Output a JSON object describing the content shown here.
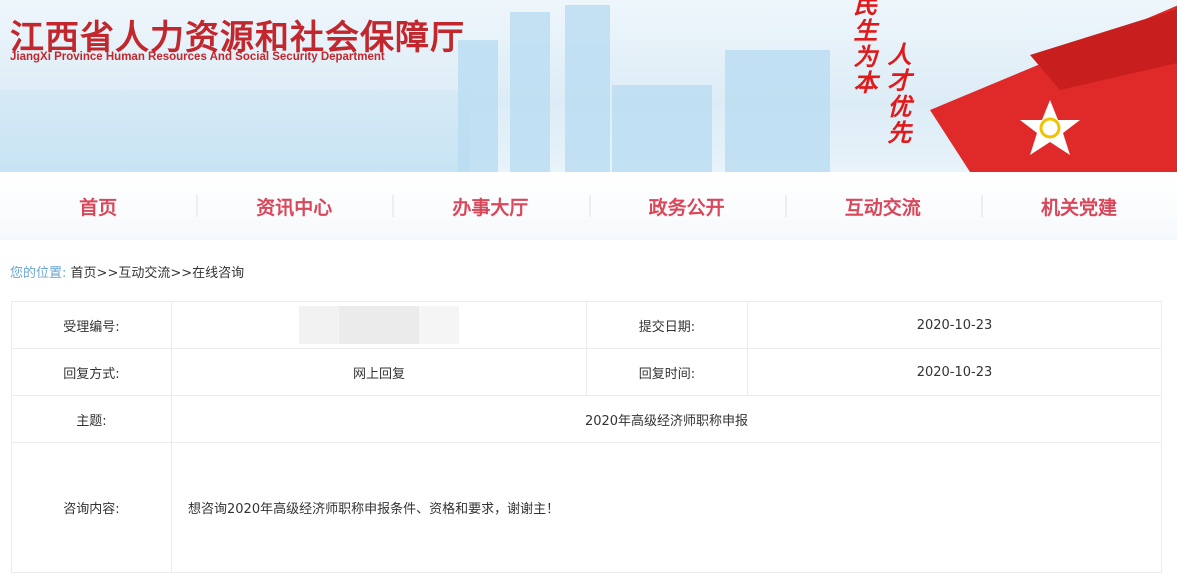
{
  "header": {
    "title_cn": "江西省人力资源和社会保障厅",
    "title_en": "JiangXi Province Human Resources And Social Security Department",
    "slogan_1": "民生为本",
    "slogan_2": "人才优先"
  },
  "nav": [
    "首页",
    "资讯中心",
    "办事大厅",
    "政务公开",
    "互动交流",
    "机关党建"
  ],
  "breadcrumb": {
    "label": "您的位置:",
    "items": [
      "首页",
      ">>互动交流",
      ">>在线咨询"
    ]
  },
  "detail": {
    "id_label": "受理编号:",
    "date_label": "提交日期:",
    "date_value": "2020-10-23",
    "reply_mode_label": "回复方式:",
    "reply_mode_value": "网上回复",
    "reply_time_label": "回复时间:",
    "reply_time_value": "2020-10-23",
    "subject_label": "主题:",
    "subject_value": "2020年高级经济师职称申报",
    "content_label": "咨询内容:",
    "content_value": "想咨询2020年高级经济师职称申报条件、资格和要求，谢谢主！"
  },
  "colors": {
    "brand": "#c1272d",
    "nav": "#d9475a",
    "crumb_label": "#6aa6d0"
  }
}
